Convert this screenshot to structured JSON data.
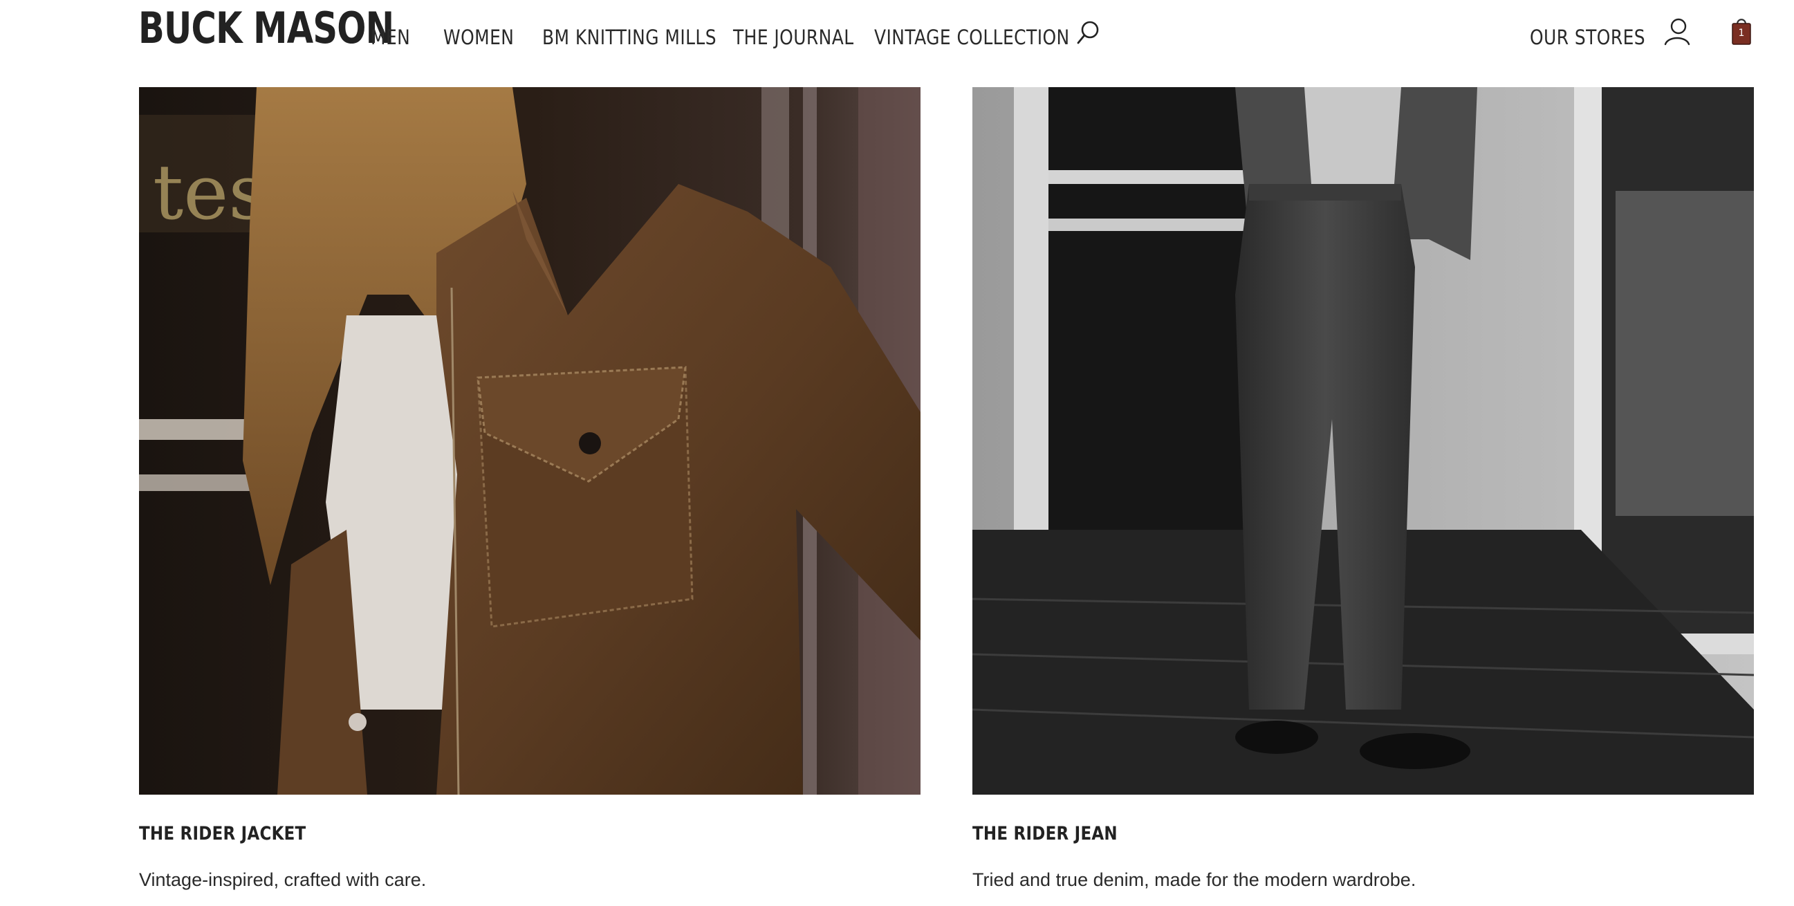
{
  "header": {
    "logo": "BUCK MASON",
    "nav": [
      {
        "label": "MEN"
      },
      {
        "label": "WOMEN"
      },
      {
        "label": "BM KNITTING MILLS"
      },
      {
        "label": "THE JOURNAL"
      },
      {
        "label": "VINTAGE COLLECTION"
      }
    ],
    "search_icon": "search-icon",
    "stores_label": "OUR STORES",
    "account_icon": "user-icon",
    "cart_icon": "shopping-bag-icon",
    "cart_count": "1",
    "cart_color": "#7a2e22"
  },
  "products": [
    {
      "title": "THE RIDER JACKET",
      "description": "Vintage-inspired, crafted with care.",
      "image_tone": "#6b4a2e"
    },
    {
      "title": "THE RIDER JEAN",
      "description": "Tried and true denim, made for the modern wardrobe.",
      "image_tone": "#3a3a3a"
    }
  ]
}
